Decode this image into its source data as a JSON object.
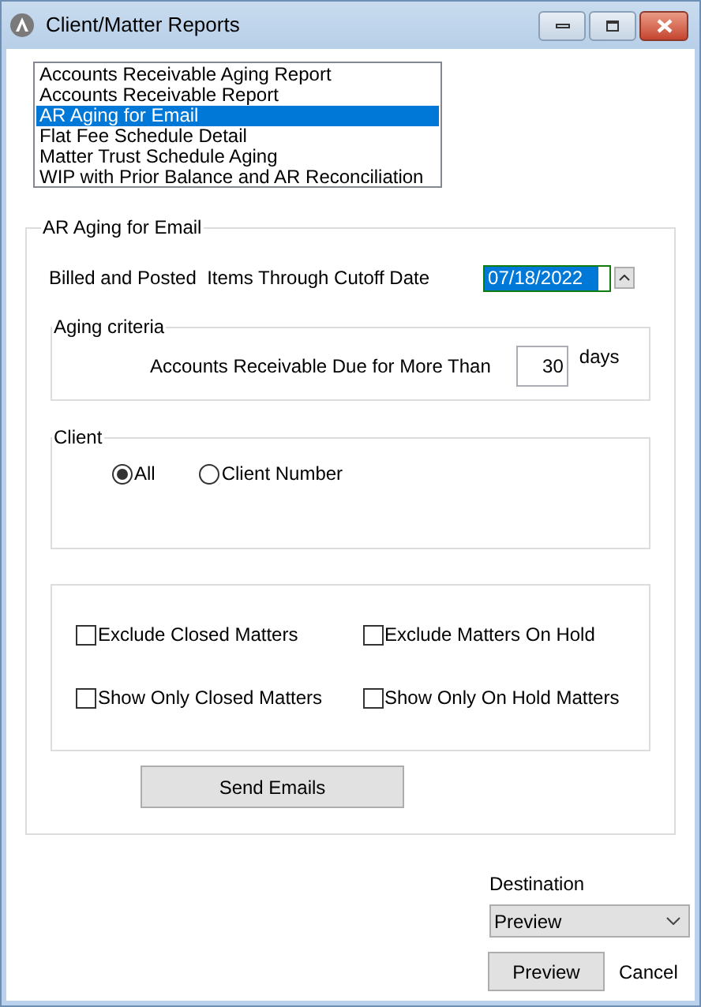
{
  "window": {
    "title": "Client/Matter Reports"
  },
  "reports": [
    {
      "label": "Accounts Receivable Aging Report",
      "selected": false
    },
    {
      "label": "Accounts Receivable Report",
      "selected": false
    },
    {
      "label": "AR Aging for Email",
      "selected": true
    },
    {
      "label": "Flat Fee Schedule Detail",
      "selected": false
    },
    {
      "label": "Matter Trust Schedule Aging",
      "selected": false
    },
    {
      "label": "WIP with Prior Balance and AR Reconciliation",
      "selected": false
    }
  ],
  "group": {
    "title": "AR Aging for Email",
    "cutoff": {
      "label": "Billed and Posted  Items Through Cutoff Date",
      "value": "07/18/2022"
    },
    "aging": {
      "title": "Aging criteria",
      "label": "Accounts Receivable Due for More Than",
      "value": "30",
      "unit": "days"
    },
    "client": {
      "title": "Client",
      "options": [
        {
          "label": "All",
          "selected": true
        },
        {
          "label": "Client Number",
          "selected": false
        }
      ]
    },
    "options": [
      {
        "label": "Exclude Closed Matters",
        "checked": false
      },
      {
        "label": "Exclude Matters On Hold",
        "checked": false
      },
      {
        "label": "Show Only Closed Matters",
        "checked": false
      },
      {
        "label": "Show Only On Hold Matters",
        "checked": false
      }
    ],
    "send_button": "Send Emails"
  },
  "destination": {
    "label": "Destination",
    "value": "Preview"
  },
  "buttons": {
    "preview": "Preview",
    "cancel": "Cancel"
  }
}
